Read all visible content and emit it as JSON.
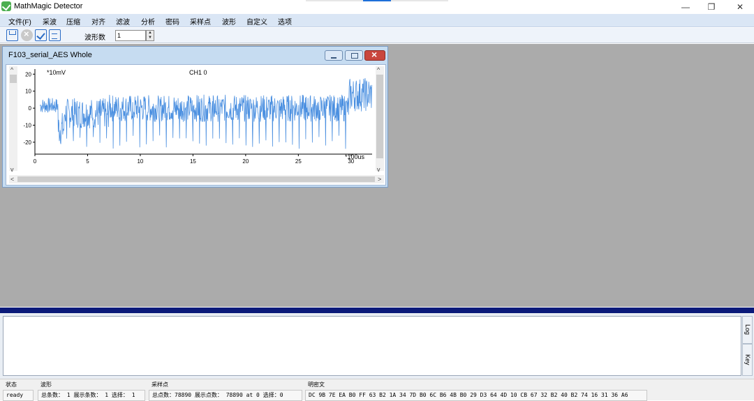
{
  "app": {
    "title": "MathMagic Detector",
    "win_controls": {
      "minimize": "—",
      "restore": "❐",
      "close": "✕"
    }
  },
  "menu": {
    "items": [
      "文件(F)",
      "采波",
      "压缩",
      "对齐",
      "滤波",
      "分析",
      "密码",
      "采样点",
      "波形",
      "自定义",
      "选项"
    ]
  },
  "toolbar": {
    "icons": [
      "save-icon",
      "close-circle-icon",
      "check-icon",
      "clipboard-icon"
    ],
    "wave_count_label": "波形数",
    "wave_count_value": "1"
  },
  "plot_window": {
    "title": "F103_serial_AES Whole",
    "y_unit": "*10mV",
    "channel": "CH1 0",
    "x_unit": "*100us"
  },
  "chart_data": {
    "type": "line",
    "title": "CH1 0",
    "xlabel": "*100us",
    "ylabel": "*10mV",
    "xlim": [
      0,
      32
    ],
    "ylim": [
      -27,
      23
    ],
    "x_ticks": [
      0,
      5,
      10,
      15,
      20,
      25,
      30
    ],
    "y_ticks": [
      20,
      10,
      0,
      -10,
      -20
    ],
    "color": "#4a8fe0",
    "segments": [
      {
        "x_start": 0.5,
        "x_end": 2.2,
        "band_low": -3,
        "band_high": 6
      },
      {
        "x_start": 2.2,
        "x_end": 2.8,
        "band_low": -22,
        "band_high": -2
      },
      {
        "x_start": 2.8,
        "x_end": 7.0,
        "band_low": -12,
        "band_high": 6
      },
      {
        "x_start": 7.0,
        "x_end": 29.8,
        "band_low": -8,
        "band_high": 8
      },
      {
        "x_start": 29.8,
        "x_end": 32.0,
        "band_low": -2,
        "band_high": 18
      }
    ],
    "spike_min": -24,
    "series": [
      {
        "values_summary": "noisy power trace; baseline ~0, band -8..8, periodic negative spikes to about -20, higher band 0..18 after x=30"
      }
    ]
  },
  "output_panel": {
    "tab_top": "Log",
    "tab_bottom": "Key"
  },
  "statusbar": {
    "state": {
      "label": "状态",
      "value": "ready"
    },
    "wave": {
      "label": "波形",
      "value": "总条数： 1 展示条数： 1 选择： 1"
    },
    "samples": {
      "label": "采样点",
      "value": "总点数：78890 展示点数： 78890 at 0 选择：0"
    },
    "ciphertext": {
      "label": "明密文",
      "value": "DC 9B 7E EA B0 FF 63 B2 1A 34 7D B0 6C B6 4B B0 29 D3 64 4D 10 CB 67 32 B2 40 B2 74 16 31 36 A6"
    }
  }
}
